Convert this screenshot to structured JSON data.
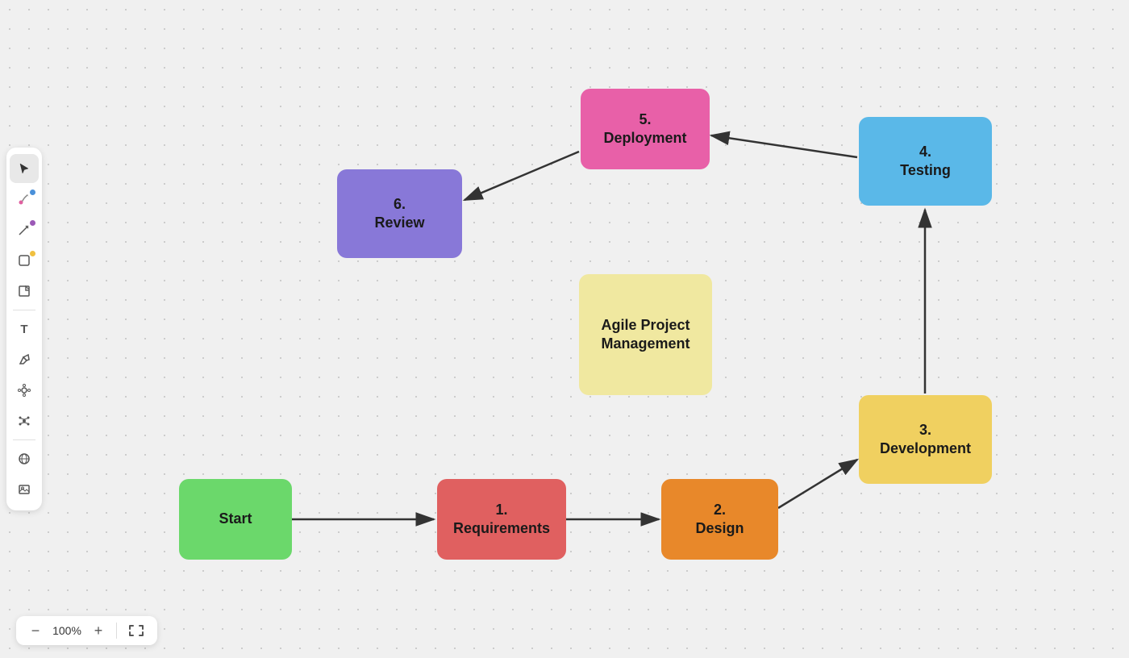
{
  "toolbar": {
    "tools": [
      {
        "name": "select",
        "icon": "▷",
        "active": true
      },
      {
        "name": "paint",
        "icon": "🎨",
        "dot": "blue"
      },
      {
        "name": "pen",
        "icon": "✒",
        "dot": "purple"
      },
      {
        "name": "shape",
        "icon": "□",
        "dot": "yellow"
      },
      {
        "name": "sticky",
        "icon": "🗒"
      },
      {
        "name": "text",
        "icon": "T"
      },
      {
        "name": "eraser",
        "icon": "✏"
      },
      {
        "name": "component",
        "icon": "⊕"
      },
      {
        "name": "network",
        "icon": "✳"
      },
      {
        "name": "globe",
        "icon": "🌐"
      },
      {
        "name": "image",
        "icon": "🖼"
      }
    ]
  },
  "nodes": {
    "start": {
      "label": "Start",
      "color": "#6bd86b"
    },
    "requirements": {
      "label1": "1.",
      "label2": "Requirements",
      "color": "#e06060"
    },
    "design": {
      "label1": "2.",
      "label2": "Design",
      "color": "#e8882a"
    },
    "development": {
      "label1": "3.",
      "label2": "Development",
      "color": "#f0d060"
    },
    "testing": {
      "label1": "4.",
      "label2": "Testing",
      "color": "#5ab8e8"
    },
    "deployment": {
      "label1": "5.",
      "label2": "Deployment",
      "color": "#e860a8"
    },
    "review": {
      "label1": "6.",
      "label2": "Review",
      "color": "#8878d8"
    },
    "agile": {
      "label1": "Agile Project",
      "label2": "Management",
      "color": "#f0e8a0"
    }
  },
  "zoom": {
    "level": "100%",
    "minus_label": "−",
    "plus_label": "+",
    "fit_label": "↔"
  }
}
